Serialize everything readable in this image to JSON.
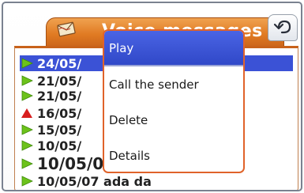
{
  "app": {
    "tab_title": "Voice messages",
    "tab_icon": "envelope-icon",
    "back_icon": "back-arrow-icon",
    "accent_color": "#e07a22",
    "selection_color": "#3b52d6"
  },
  "messages": [
    {
      "label": "24/05/",
      "status": "new",
      "selected": true
    },
    {
      "label": "21/05/",
      "status": "new",
      "selected": false
    },
    {
      "label": "21/05/",
      "status": "new",
      "selected": false
    },
    {
      "label": "16/05/",
      "status": "urgent",
      "selected": false
    },
    {
      "label": "15/05/",
      "status": "new",
      "selected": false
    },
    {
      "label": "10/05/",
      "status": "new",
      "selected": false
    },
    {
      "label": "10/05/07 Administrator",
      "status": "new",
      "selected": false
    },
    {
      "label": "10/05/07 ada da",
      "status": "new",
      "selected": false
    }
  ],
  "context_menu": {
    "items": [
      {
        "label": "Play",
        "selected": true
      },
      {
        "label": "Call the sender",
        "selected": false
      },
      {
        "label": "Delete",
        "selected": false
      },
      {
        "label": "Details",
        "selected": false
      }
    ]
  }
}
